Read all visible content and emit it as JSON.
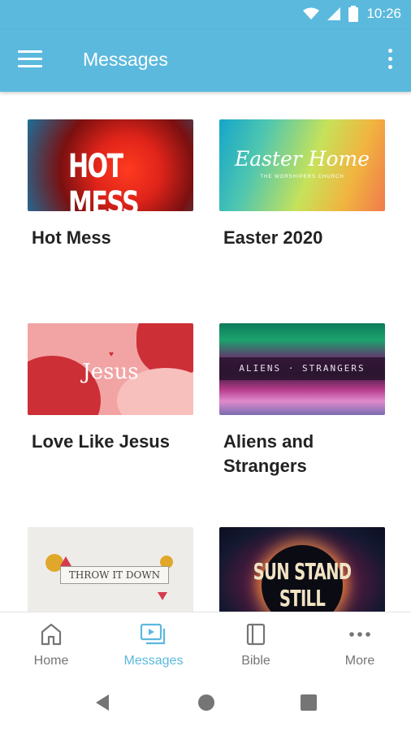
{
  "status_bar": {
    "time": "10:26",
    "icons": [
      "wifi-icon",
      "signal-icon",
      "battery-icon"
    ]
  },
  "app_bar": {
    "title": "Messages",
    "menu_icon": "menu-icon",
    "overflow_icon": "more-vert-icon"
  },
  "messages": [
    {
      "title": "Hot Mess",
      "artwork_text": "HOT MESS"
    },
    {
      "title": "Easter 2020",
      "artwork_text": "Easter Home",
      "artwork_subtext": "THE WORSHIPERS CHURCH"
    },
    {
      "title": "Love Like Jesus",
      "artwork_text": "Jesus"
    },
    {
      "title": "Aliens and Strangers",
      "artwork_text": "ALIENS · STRANGERS"
    },
    {
      "title": "",
      "artwork_text": "THROW IT DOWN"
    },
    {
      "title": "",
      "artwork_text": "SUN STAND STILL"
    }
  ],
  "bottom_nav": {
    "items": [
      {
        "label": "Home",
        "icon": "home-icon",
        "active": false
      },
      {
        "label": "Messages",
        "icon": "video-library-icon",
        "active": true
      },
      {
        "label": "Bible",
        "icon": "book-icon",
        "active": false
      },
      {
        "label": "More",
        "icon": "more-horiz-icon",
        "active": false
      }
    ]
  },
  "colors": {
    "primary": "#5bb9dd",
    "nav_inactive": "#757575",
    "title_text": "#222222"
  }
}
